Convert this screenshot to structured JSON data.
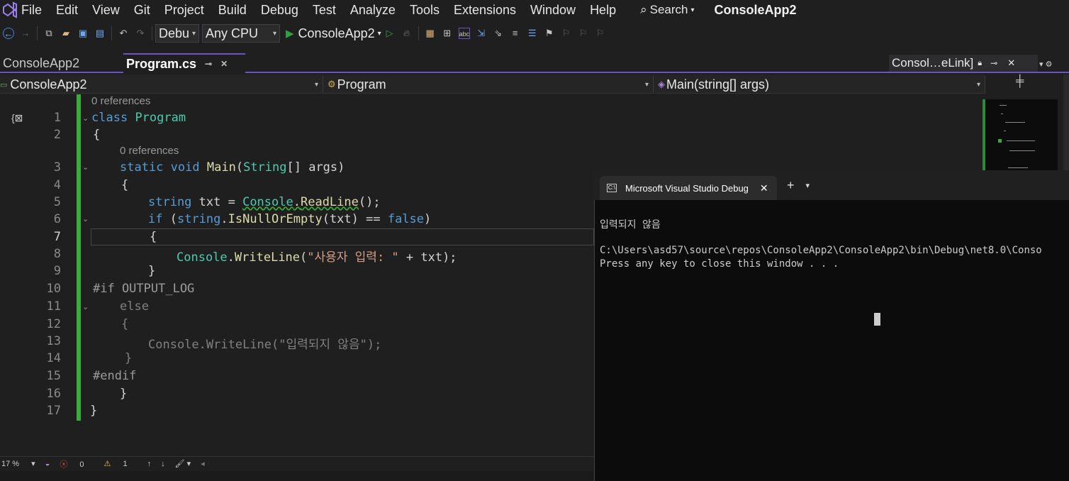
{
  "menu": {
    "items": [
      "File",
      "Edit",
      "View",
      "Git",
      "Project",
      "Build",
      "Debug",
      "Test",
      "Analyze",
      "Tools",
      "Extensions",
      "Window",
      "Help"
    ],
    "search_label": "Search",
    "solution_name": "ConsoleApp2"
  },
  "toolbar": {
    "config": "Debu",
    "platform": "Any CPU",
    "start_target": "ConsoleApp2"
  },
  "tabs": {
    "inactive": "ConsoleApp2",
    "active": "Program.cs",
    "right": "Consol…eLink]"
  },
  "navbar": {
    "project": "ConsoleApp2",
    "class": "Program",
    "member": "Main(string[] args)"
  },
  "editor": {
    "ref_label": "0 references",
    "line_numbers": [
      "1",
      "2",
      "3",
      "4",
      "5",
      "6",
      "7",
      "8",
      "9",
      "10",
      "11",
      "12",
      "13",
      "14",
      "15",
      "16",
      "17"
    ],
    "current_line": "7",
    "code": {
      "l1_kw": "class",
      "l1_name": "Program",
      "l2": "{",
      "l3_kw1": "static",
      "l3_kw2": "void",
      "l3_fn": "Main",
      "l3_open": "(",
      "l3_ty": "String",
      "l3_rest": "[] args)",
      "l4": "{",
      "l5_kw": "string",
      "l5_mid": " txt = ",
      "l5_ty": "Console",
      "l5_dot": ".",
      "l5_fn": "ReadLine",
      "l5_end": "();",
      "l6_kw": "if",
      "l6_a": " (",
      "l6_kw2": "string",
      "l6_dot": ".",
      "l6_fn": "IsNullOrEmpty",
      "l6_b": "(txt) == ",
      "l6_kw3": "false",
      "l6_c": ")",
      "l7": "{",
      "l8_ty": "Console",
      "l8_dot": ".",
      "l8_fn": "WriteLine",
      "l8_a": "(",
      "l8_str": "\"사용자 입력: \"",
      "l8_b": " + txt);",
      "l9": "}",
      "l10": "#if OUTPUT_LOG",
      "l11": "else",
      "l12": "{",
      "l13_ty": "Console",
      "l13_dot": ".",
      "l13_fn": "WriteLine",
      "l13_a": "(",
      "l13_str": "\"입력되지 않음\"",
      "l13_b": ");",
      "l14": "}",
      "l15": "#endif",
      "l16": "}",
      "l17": "}"
    }
  },
  "status": {
    "zoom": "17 %",
    "errors": "0",
    "warnings": "1"
  },
  "terminal": {
    "tab_title": "Microsoft Visual Studio Debug",
    "line1": "입력되지 않음",
    "line2": "C:\\Users\\asd57\\source\\repos\\ConsoleApp2\\ConsoleApp2\\bin\\Debug\\net8.0\\Conso",
    "line3": "Press any key to close this window . . ."
  },
  "colors": {
    "accent": "#6e52c2",
    "change_margin": "#3bab3b",
    "keyword": "#569cd6",
    "type": "#4ec9b0",
    "method": "#dcdcaa",
    "string": "#d69d85"
  }
}
